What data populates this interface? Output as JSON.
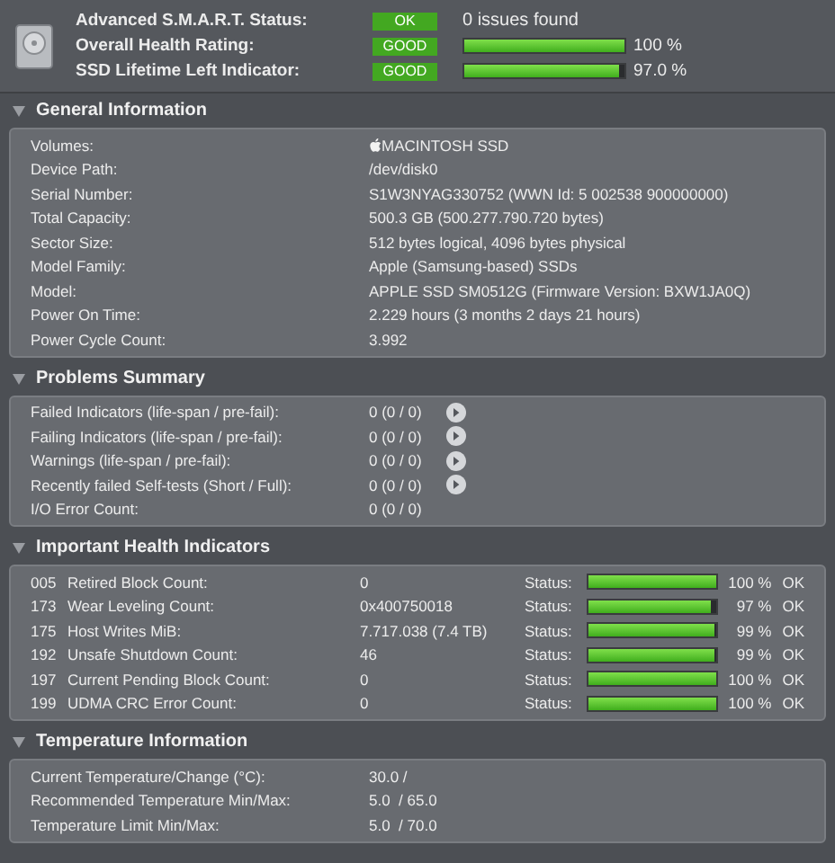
{
  "status": [
    {
      "label": "Advanced S.M.A.R.T. Status:",
      "badge": "OK",
      "kind": "text",
      "text": "0 issues found"
    },
    {
      "label": "Overall Health Rating:",
      "badge": "GOOD",
      "kind": "bar",
      "level": 1.0,
      "text": "100 %"
    },
    {
      "label": "SSD Lifetime Left Indicator:",
      "badge": "GOOD",
      "kind": "bar",
      "level": 0.97,
      "text": "97.0 %"
    }
  ],
  "general": {
    "title": "General Information",
    "expanded": true,
    "rows": [
      {
        "label": "Volumes:",
        "value": "MACINTOSH SSD",
        "kind": "volume"
      },
      {
        "label": "Device Path:",
        "value": "/dev/disk0",
        "kind": "plain"
      },
      {
        "label": "Serial Number:",
        "value": "S1W3NYAG330752 (WWN Id: 5 002538 900000000)",
        "kind": "plain"
      },
      {
        "label": "Total Capacity:",
        "value": "500.3 GB (500.277.790.720 bytes)",
        "kind": "plain"
      },
      {
        "label": "Sector Size:",
        "value": "512 bytes logical, 4096 bytes physical",
        "kind": "plain"
      },
      {
        "label": "Model Family:",
        "value": "Apple (Samsung-based) SSDs",
        "kind": "plain"
      },
      {
        "label": "Model:",
        "value": "APPLE SSD SM0512G  (Firmware Version: BXW1JA0Q)",
        "kind": "plain"
      },
      {
        "label": "Power On Time:",
        "value": "2.229 hours (3 months 2 days 21 hours)",
        "kind": "plain"
      },
      {
        "label": "Power Cycle Count:",
        "value": "3.992",
        "kind": "plain"
      }
    ]
  },
  "problems": {
    "title": "Problems Summary",
    "expanded": true,
    "rows": [
      {
        "label": "Failed Indicators (life-span / pre-fail):",
        "value": "0 (0 / 0)",
        "details": true
      },
      {
        "label": "Failing Indicators (life-span / pre-fail):",
        "value": "0 (0 / 0)",
        "details": true
      },
      {
        "label": "Warnings (life-span / pre-fail):",
        "value": "0 (0 / 0)",
        "details": true
      },
      {
        "label": "Recently failed Self-tests (Short / Full):",
        "value": "0 (0 / 0)",
        "details": true
      },
      {
        "label": "I/O Error Count:",
        "value": "0 (0 / 0)",
        "details": false
      }
    ]
  },
  "health": {
    "title": "Important Health Indicators",
    "expanded": true,
    "rows": [
      {
        "id": "005",
        "label": "Retired Block Count:",
        "value": "0",
        "status_label": "Status:",
        "level": 1.0,
        "percent": "100 %",
        "result": "OK"
      },
      {
        "id": "173",
        "label": "Wear Leveling Count:",
        "value": "0x400750018",
        "status_label": "Status:",
        "level": 0.97,
        "percent": "97 %",
        "result": "OK"
      },
      {
        "id": "175",
        "label": "Host Writes MiB:",
        "value": "7.717.038 (7.4 TB)",
        "status_label": "Status:",
        "level": 0.99,
        "percent": "99 %",
        "result": "OK"
      },
      {
        "id": "192",
        "label": "Unsafe Shutdown Count:",
        "value": "46",
        "status_label": "Status:",
        "level": 0.99,
        "percent": "99 %",
        "result": "OK"
      },
      {
        "id": "197",
        "label": "Current Pending Block Count:",
        "value": "0",
        "status_label": "Status:",
        "level": 1.0,
        "percent": "100 %",
        "result": "OK"
      },
      {
        "id": "199",
        "label": "UDMA CRC Error Count:",
        "value": "0",
        "status_label": "Status:",
        "level": 1.0,
        "percent": "100 %",
        "result": "OK"
      }
    ]
  },
  "temperature": {
    "title": "Temperature Information",
    "expanded": true,
    "rows": [
      {
        "label": "Current Temperature/Change (°C):",
        "value": "30.0 /"
      },
      {
        "label": "Recommended Temperature Min/Max:",
        "value": "5.0  / 65.0"
      },
      {
        "label": "Temperature Limit Min/Max:",
        "value": "5.0  / 70.0"
      }
    ]
  }
}
